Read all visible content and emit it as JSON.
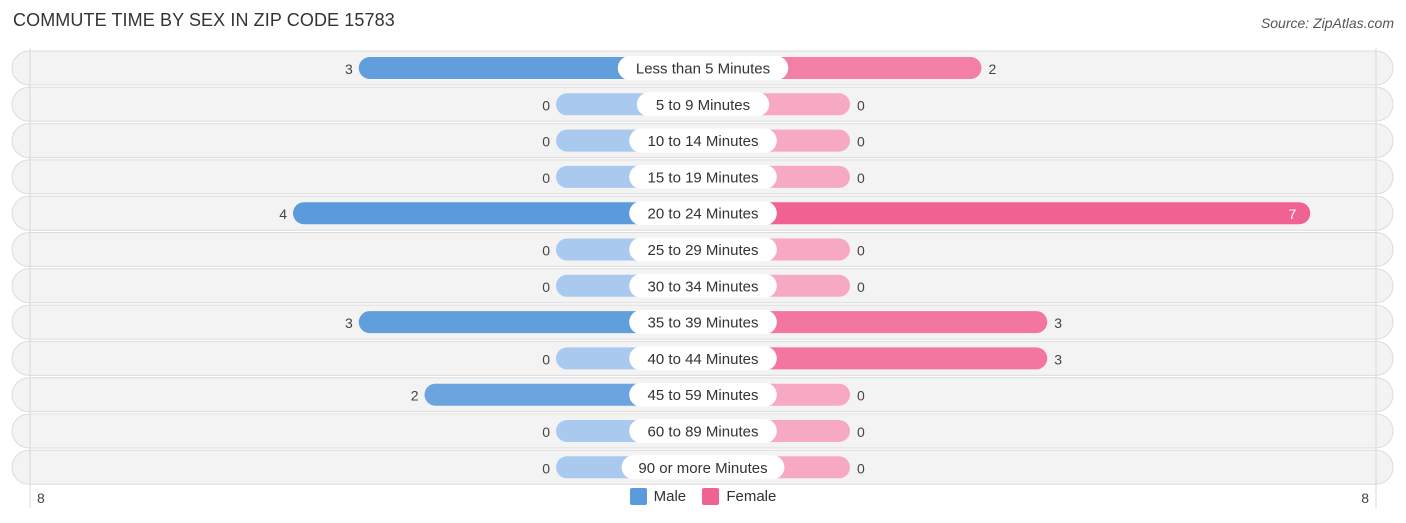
{
  "title": "COMMUTE TIME BY SEX IN ZIP CODE 15783",
  "source": "Source: ZipAtlas.com",
  "legend": [
    {
      "name": "Male",
      "color": "#5b9bdb"
    },
    {
      "name": "Female",
      "color": "#f06292"
    }
  ],
  "chart_data": {
    "type": "bar",
    "orientation": "horizontal-diverging",
    "title": "COMMUTE TIME BY SEX IN ZIP CODE 15783",
    "categories": [
      "Less than 5 Minutes",
      "5 to 9 Minutes",
      "10 to 14 Minutes",
      "15 to 19 Minutes",
      "20 to 24 Minutes",
      "25 to 29 Minutes",
      "30 to 34 Minutes",
      "35 to 39 Minutes",
      "40 to 44 Minutes",
      "45 to 59 Minutes",
      "60 to 89 Minutes",
      "90 or more Minutes"
    ],
    "series": [
      {
        "name": "Male",
        "side": "left",
        "color": "#5b9bdb",
        "light_color": "#aac9ee",
        "values": [
          3,
          0,
          0,
          0,
          4,
          0,
          0,
          3,
          0,
          2,
          0,
          0
        ]
      },
      {
        "name": "Female",
        "side": "right",
        "color": "#f06292",
        "light_color": "#f7a9c3",
        "values": [
          2,
          0,
          0,
          0,
          7,
          0,
          0,
          3,
          3,
          0,
          0,
          0
        ]
      }
    ],
    "axis": {
      "left_max_label": "8",
      "right_max_label": "8",
      "max": 8
    },
    "xlabel": "",
    "ylabel": "",
    "legend_position": "bottom-center",
    "grid": true
  }
}
